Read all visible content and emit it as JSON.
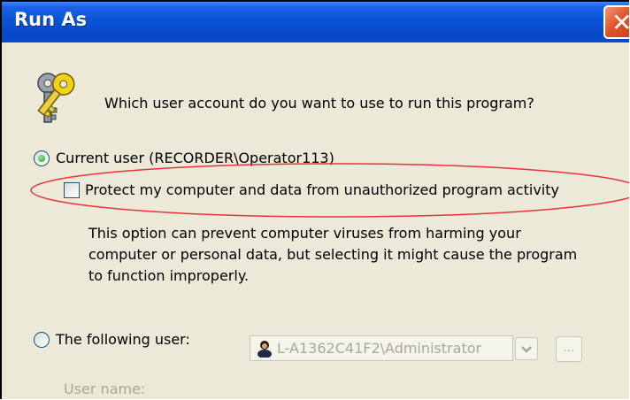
{
  "window": {
    "title": "Run As"
  },
  "prompt": "Which user account do you want to use to run this program?",
  "current_user": {
    "label": "Current user (RECORDER\\Operator113)",
    "selected": true
  },
  "protect": {
    "label": "Protect my computer and data from unauthorized program activity",
    "checked": false
  },
  "description": [
    "This option can prevent computer viruses from harming your",
    "computer or personal data, but selecting it might cause the program",
    "to function improperly."
  ],
  "following_user": {
    "label": "The following user:",
    "selected": false
  },
  "user_name": {
    "label": "User name:",
    "value": "L-A1362C41F2\\Administrator"
  },
  "browse_label": "...",
  "colors": {
    "titlebar": "#0a53d8",
    "highlight_ellipse": "#e8333a",
    "face": "#ece9d8"
  },
  "icons": {
    "close": "close-icon",
    "keys": "keys-icon",
    "user": "user-icon",
    "dropdown": "chevron-down-icon"
  }
}
